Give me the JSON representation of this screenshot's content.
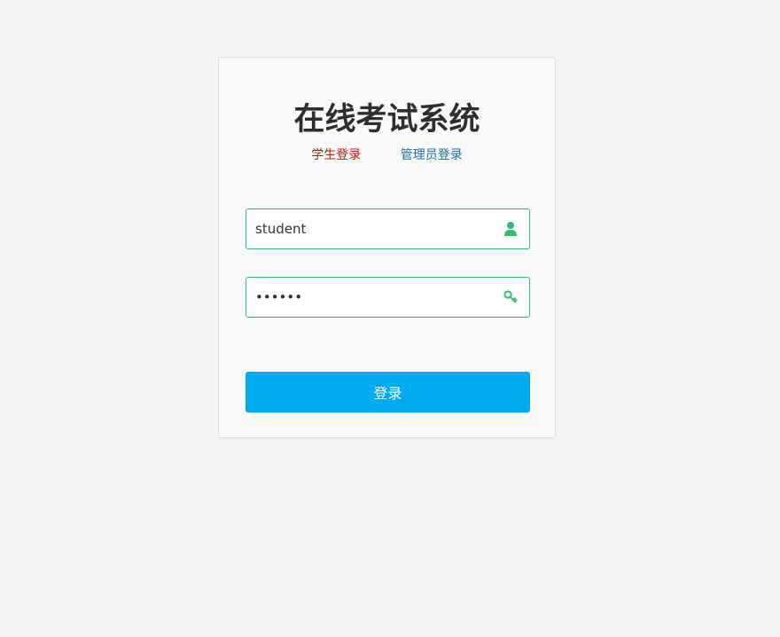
{
  "header": {
    "title": "在线考试系统"
  },
  "tabs": {
    "student": "学生登录",
    "admin": "管理员登录"
  },
  "form": {
    "username_value": "student",
    "password_value": "••••••",
    "login_label": "登录"
  },
  "icons": {
    "username": "user-icon",
    "password": "key-icon"
  },
  "colors": {
    "page_background": "#f4f4f4",
    "title": "#2e2e2e",
    "student_tab": "#cc1111",
    "admin_tab": "#1a6fa0",
    "input_border": "#2ebd6f",
    "icon": "#2ebd6f",
    "button": "#00aaee"
  }
}
